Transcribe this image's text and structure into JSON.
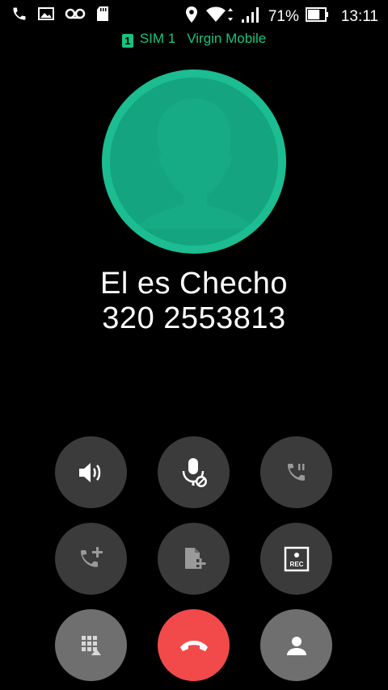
{
  "status_bar": {
    "battery_percent": "71%",
    "time": "13:11",
    "battery_level": 0.71,
    "icons_left": [
      "phone-icon",
      "image-icon",
      "voicemail-icon",
      "sd-card-icon"
    ],
    "icons_right": [
      "location-icon",
      "wifi-icon",
      "signal-icon",
      "battery-icon"
    ]
  },
  "sim_info": {
    "badge": "1",
    "sim_label": "SIM 1",
    "carrier": "Virgin Mobile",
    "color": "#16c47d"
  },
  "caller": {
    "name": "El es Checho",
    "number": "320 2553813",
    "avatar_color": "#1bbd91"
  },
  "controls": [
    {
      "id": "speaker",
      "icon": "speaker-icon"
    },
    {
      "id": "mute",
      "icon": "mic-off-icon"
    },
    {
      "id": "hold",
      "icon": "hold-call-icon"
    },
    {
      "id": "add-call",
      "icon": "add-call-icon"
    },
    {
      "id": "note",
      "icon": "add-note-icon"
    },
    {
      "id": "record",
      "icon": "record-icon",
      "label": "REC"
    },
    {
      "id": "keypad",
      "icon": "dialpad-icon"
    },
    {
      "id": "end-call",
      "icon": "end-call-icon",
      "color": "#f24a4a"
    },
    {
      "id": "contact",
      "icon": "contact-icon"
    }
  ]
}
